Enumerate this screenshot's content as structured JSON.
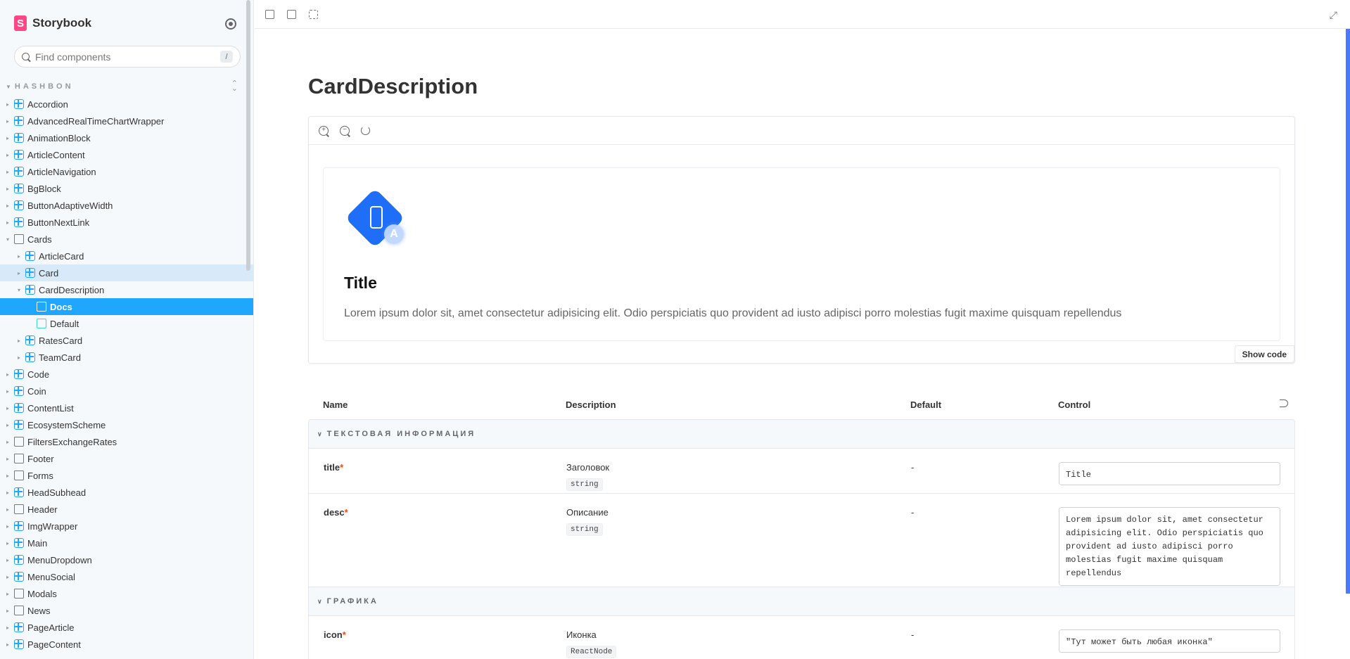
{
  "sidebar": {
    "brand": "Storybook",
    "search_placeholder": "Find components",
    "search_shortcut": "/",
    "section": "HASHBON",
    "items": [
      {
        "label": "Accordion",
        "type": "component",
        "depth": 0,
        "state": "collapsed"
      },
      {
        "label": "AdvancedRealTimeChartWrapper",
        "type": "component",
        "depth": 0,
        "state": "collapsed"
      },
      {
        "label": "AnimationBlock",
        "type": "component",
        "depth": 0,
        "state": "collapsed"
      },
      {
        "label": "ArticleContent",
        "type": "component",
        "depth": 0,
        "state": "collapsed"
      },
      {
        "label": "ArticleNavigation",
        "type": "component",
        "depth": 0,
        "state": "collapsed"
      },
      {
        "label": "BgBlock",
        "type": "component",
        "depth": 0,
        "state": "collapsed"
      },
      {
        "label": "ButtonAdaptiveWidth",
        "type": "component",
        "depth": 0,
        "state": "collapsed"
      },
      {
        "label": "ButtonNextLink",
        "type": "component",
        "depth": 0,
        "state": "collapsed"
      },
      {
        "label": "Cards",
        "type": "folder",
        "depth": 0,
        "state": "expanded"
      },
      {
        "label": "ArticleCard",
        "type": "component",
        "depth": 1,
        "state": "collapsed"
      },
      {
        "label": "Card",
        "type": "component",
        "depth": 1,
        "state": "collapsed",
        "highlight": "light"
      },
      {
        "label": "CardDescription",
        "type": "component",
        "depth": 1,
        "state": "expanded"
      },
      {
        "label": "Docs",
        "type": "doc",
        "depth": 2,
        "highlight": "selected"
      },
      {
        "label": "Default",
        "type": "story",
        "depth": 2
      },
      {
        "label": "RatesCard",
        "type": "component",
        "depth": 1,
        "state": "collapsed"
      },
      {
        "label": "TeamCard",
        "type": "component",
        "depth": 1,
        "state": "collapsed"
      },
      {
        "label": "Code",
        "type": "component",
        "depth": 0,
        "state": "collapsed"
      },
      {
        "label": "Coin",
        "type": "component",
        "depth": 0,
        "state": "collapsed"
      },
      {
        "label": "ContentList",
        "type": "component",
        "depth": 0,
        "state": "collapsed"
      },
      {
        "label": "EcosystemScheme",
        "type": "component",
        "depth": 0,
        "state": "collapsed"
      },
      {
        "label": "FiltersExchangeRates",
        "type": "folder",
        "depth": 0,
        "state": "collapsed"
      },
      {
        "label": "Footer",
        "type": "folder",
        "depth": 0,
        "state": "collapsed"
      },
      {
        "label": "Forms",
        "type": "folder",
        "depth": 0,
        "state": "collapsed"
      },
      {
        "label": "HeadSubhead",
        "type": "component",
        "depth": 0,
        "state": "collapsed"
      },
      {
        "label": "Header",
        "type": "folder",
        "depth": 0,
        "state": "collapsed"
      },
      {
        "label": "ImgWrapper",
        "type": "component",
        "depth": 0,
        "state": "collapsed"
      },
      {
        "label": "Main",
        "type": "component",
        "depth": 0,
        "state": "collapsed"
      },
      {
        "label": "MenuDropdown",
        "type": "component",
        "depth": 0,
        "state": "collapsed"
      },
      {
        "label": "MenuSocial",
        "type": "component",
        "depth": 0,
        "state": "collapsed"
      },
      {
        "label": "Modals",
        "type": "folder",
        "depth": 0,
        "state": "collapsed"
      },
      {
        "label": "News",
        "type": "folder",
        "depth": 0,
        "state": "collapsed"
      },
      {
        "label": "PageArticle",
        "type": "component",
        "depth": 0,
        "state": "collapsed"
      },
      {
        "label": "PageContent",
        "type": "component",
        "depth": 0,
        "state": "collapsed"
      }
    ]
  },
  "toolbar": {
    "icons": [
      "image-icon",
      "grid-icon",
      "outline-icon"
    ],
    "fullscreen_icon": "fullscreen-icon"
  },
  "docs": {
    "title": "CardDescription",
    "preview": {
      "badge_letter": "A",
      "card_title": "Title",
      "card_desc": "Lorem ipsum dolor sit, amet consectetur adipisicing elit. Odio perspiciatis quo provident ad iusto adipisci porro molestias fugit maxime quisquam repellendus"
    },
    "show_code": "Show code",
    "columns": {
      "name": "Name",
      "description": "Description",
      "default": "Default",
      "control": "Control"
    },
    "groups": [
      {
        "label": "ТЕКСТОВАЯ ИНФОРМАЦИЯ",
        "args": [
          {
            "name": "title",
            "required": "*",
            "desc": "Заголовок",
            "type": "string",
            "default": "-",
            "value": "Title"
          },
          {
            "name": "desc",
            "required": "*",
            "desc": "Описание",
            "type": "string",
            "default": "-",
            "value": "Lorem ipsum dolor sit, amet consectetur adipisicing elit. Odio perspiciatis quo provident ad iusto adipisci porro molestias fugit maxime quisquam repellendus"
          }
        ]
      },
      {
        "label": "ГРАФИКА",
        "args": [
          {
            "name": "icon",
            "required": "*",
            "desc": "Иконка",
            "type": "ReactNode",
            "default": "-",
            "value": "\"Тут может быть любая иконка\""
          }
        ]
      }
    ]
  },
  "colors": {
    "accent": "#1ea7fd",
    "brand": "#ff4785",
    "selected_light": "#d8eafa",
    "required": "#ff4400"
  }
}
